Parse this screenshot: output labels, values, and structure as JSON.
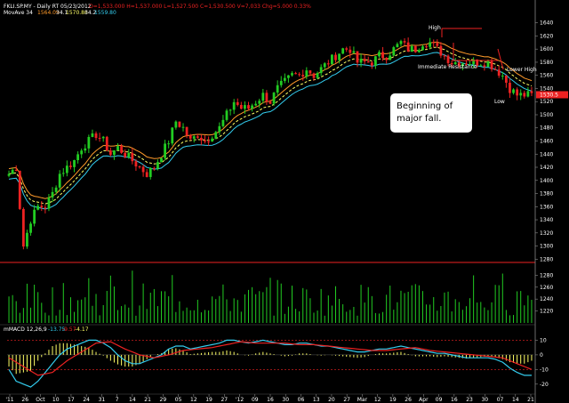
{
  "header": {
    "symbol": "FKLI.SP.MY - Daily RT",
    "date": "05/23/2012",
    "ohlc": "O=1,533.000  H=1,537.000  L=1,527.500  C=1,530.500  V=7,033  Chg=5.000  0.33%",
    "mov_label": "MovAve 34",
    "mov_values": [
      "1564.09",
      "34.1",
      "1570.86",
      "34.2",
      "1559.80"
    ]
  },
  "macd_label": "mMACD 12,26,9",
  "macd_values": [
    "-13.75",
    "-9.57",
    "-4.17"
  ],
  "colors": {
    "background": "#000000",
    "up_candle": "#22cc22",
    "down_candle": "#ee2222",
    "ma_orange": "#ff9a2a",
    "ma_yellow": "#ffff66",
    "ma_cyan": "#33ccee",
    "macd_line": "#33ccee",
    "signal_line": "#ee2222",
    "histogram": "#ffff66",
    "volume": "#22cc22",
    "support_line": "#ee2222"
  },
  "annotations": {
    "high": "High",
    "immediate_resistance": "Immediate Resistance",
    "lower_high": "Lower High",
    "low": "Low",
    "callout": [
      "Beginning of",
      "major fall."
    ]
  },
  "chart_data": {
    "type": "candlestick",
    "price_axis": {
      "ylim": [
        1275,
        1645
      ],
      "ticks": [
        1640,
        1620,
        1600,
        1580,
        1560,
        1540,
        1520,
        1500,
        1480,
        1460,
        1440,
        1420,
        1400,
        1380,
        1360,
        1340,
        1320,
        1300,
        1280
      ],
      "current_price": 1530.5
    },
    "volume_axis": {
      "ylim": [
        1200,
        1300
      ],
      "ticks": [
        1280,
        1260,
        1240,
        1220
      ]
    },
    "macd_axis": {
      "ylim": [
        -25,
        20
      ],
      "ticks": [
        10,
        0,
        -10,
        -20
      ]
    },
    "x_ticks": [
      "'11",
      "26",
      "Oct",
      "10",
      "17",
      "24",
      "31",
      "7",
      "14",
      "21",
      "29",
      "05",
      "12",
      "19",
      "27",
      "'12",
      "09",
      "16",
      "30",
      "06",
      "13",
      "20",
      "27",
      "Mar",
      "12",
      "19",
      "26",
      "Apr",
      "09",
      "16",
      "23",
      "30",
      "07",
      "14",
      "21"
    ],
    "n_bars": 145,
    "price_anchors": [
      [
        0,
        1410
      ],
      [
        2,
        1420
      ],
      [
        4,
        1300
      ],
      [
        6,
        1340
      ],
      [
        8,
        1360
      ],
      [
        10,
        1360
      ],
      [
        12,
        1380
      ],
      [
        14,
        1410
      ],
      [
        16,
        1420
      ],
      [
        18,
        1430
      ],
      [
        20,
        1450
      ],
      [
        22,
        1460
      ],
      [
        24,
        1470
      ],
      [
        26,
        1460
      ],
      [
        28,
        1440
      ],
      [
        30,
        1450
      ],
      [
        32,
        1440
      ],
      [
        34,
        1430
      ],
      [
        36,
        1420
      ],
      [
        38,
        1410
      ],
      [
        40,
        1420
      ],
      [
        42,
        1440
      ],
      [
        44,
        1460
      ],
      [
        46,
        1490
      ],
      [
        48,
        1480
      ],
      [
        50,
        1460
      ],
      [
        52,
        1470
      ],
      [
        54,
        1460
      ],
      [
        56,
        1470
      ],
      [
        58,
        1480
      ],
      [
        60,
        1500
      ],
      [
        62,
        1520
      ],
      [
        64,
        1510
      ],
      [
        66,
        1510
      ],
      [
        68,
        1520
      ],
      [
        70,
        1530
      ],
      [
        72,
        1520
      ],
      [
        74,
        1540
      ],
      [
        76,
        1550
      ],
      [
        78,
        1560
      ],
      [
        80,
        1560
      ],
      [
        82,
        1570
      ],
      [
        84,
        1560
      ],
      [
        86,
        1570
      ],
      [
        88,
        1580
      ],
      [
        90,
        1590
      ],
      [
        92,
        1600
      ],
      [
        94,
        1600
      ],
      [
        96,
        1580
      ],
      [
        98,
        1580
      ],
      [
        100,
        1580
      ],
      [
        102,
        1590
      ],
      [
        104,
        1590
      ],
      [
        106,
        1600
      ],
      [
        108,
        1610
      ],
      [
        110,
        1600
      ],
      [
        112,
        1600
      ],
      [
        114,
        1610
      ],
      [
        116,
        1610
      ],
      [
        118,
        1600
      ],
      [
        120,
        1590
      ],
      [
        122,
        1580
      ],
      [
        124,
        1580
      ],
      [
        126,
        1580
      ],
      [
        128,
        1580
      ],
      [
        130,
        1580
      ],
      [
        132,
        1580
      ],
      [
        134,
        1570
      ],
      [
        136,
        1560
      ],
      [
        138,
        1540
      ],
      [
        140,
        1530
      ],
      [
        142,
        1530
      ],
      [
        144,
        1530
      ]
    ],
    "macd_anchors": [
      [
        0,
        -10
      ],
      [
        2,
        -18
      ],
      [
        4,
        -20
      ],
      [
        6,
        -22
      ],
      [
        8,
        -18
      ],
      [
        10,
        -12
      ],
      [
        12,
        -6
      ],
      [
        14,
        0
      ],
      [
        16,
        4
      ],
      [
        18,
        6
      ],
      [
        20,
        8
      ],
      [
        22,
        10
      ],
      [
        24,
        10
      ],
      [
        26,
        8
      ],
      [
        28,
        5
      ],
      [
        30,
        0
      ],
      [
        32,
        -4
      ],
      [
        34,
        -6
      ],
      [
        36,
        -6
      ],
      [
        38,
        -4
      ],
      [
        40,
        -2
      ],
      [
        42,
        0
      ],
      [
        44,
        4
      ],
      [
        46,
        6
      ],
      [
        48,
        6
      ],
      [
        50,
        4
      ],
      [
        52,
        5
      ],
      [
        54,
        6
      ],
      [
        56,
        7
      ],
      [
        58,
        8
      ],
      [
        60,
        10
      ],
      [
        62,
        10
      ],
      [
        64,
        9
      ],
      [
        66,
        8
      ],
      [
        68,
        9
      ],
      [
        70,
        10
      ],
      [
        72,
        9
      ],
      [
        74,
        8
      ],
      [
        76,
        7
      ],
      [
        78,
        7
      ],
      [
        80,
        8
      ],
      [
        82,
        8
      ],
      [
        84,
        7
      ],
      [
        86,
        6
      ],
      [
        88,
        6
      ],
      [
        90,
        5
      ],
      [
        92,
        4
      ],
      [
        94,
        3
      ],
      [
        96,
        2
      ],
      [
        98,
        2
      ],
      [
        100,
        3
      ],
      [
        102,
        4
      ],
      [
        104,
        4
      ],
      [
        106,
        5
      ],
      [
        108,
        6
      ],
      [
        110,
        5
      ],
      [
        112,
        4
      ],
      [
        114,
        3
      ],
      [
        116,
        2
      ],
      [
        118,
        1
      ],
      [
        120,
        1
      ],
      [
        122,
        0
      ],
      [
        124,
        -1
      ],
      [
        126,
        -2
      ],
      [
        128,
        -2
      ],
      [
        130,
        -2
      ],
      [
        132,
        -2
      ],
      [
        134,
        -3
      ],
      [
        136,
        -5
      ],
      [
        138,
        -9
      ],
      [
        140,
        -12
      ],
      [
        142,
        -14
      ],
      [
        144,
        -14
      ]
    ],
    "signal_anchors": [
      [
        0,
        -2
      ],
      [
        4,
        -8
      ],
      [
        8,
        -14
      ],
      [
        12,
        -12
      ],
      [
        16,
        -4
      ],
      [
        20,
        2
      ],
      [
        24,
        8
      ],
      [
        28,
        9
      ],
      [
        32,
        4
      ],
      [
        36,
        0
      ],
      [
        40,
        -2
      ],
      [
        44,
        0
      ],
      [
        48,
        3
      ],
      [
        52,
        4
      ],
      [
        56,
        5
      ],
      [
        60,
        7
      ],
      [
        64,
        9
      ],
      [
        68,
        8
      ],
      [
        72,
        8
      ],
      [
        76,
        8
      ],
      [
        80,
        7
      ],
      [
        84,
        7
      ],
      [
        88,
        6
      ],
      [
        92,
        5
      ],
      [
        96,
        4
      ],
      [
        100,
        3
      ],
      [
        104,
        3
      ],
      [
        108,
        4
      ],
      [
        112,
        5
      ],
      [
        116,
        3
      ],
      [
        120,
        2
      ],
      [
        124,
        1
      ],
      [
        128,
        0
      ],
      [
        132,
        -1
      ],
      [
        136,
        -2
      ],
      [
        140,
        -6
      ],
      [
        144,
        -10
      ]
    ]
  }
}
